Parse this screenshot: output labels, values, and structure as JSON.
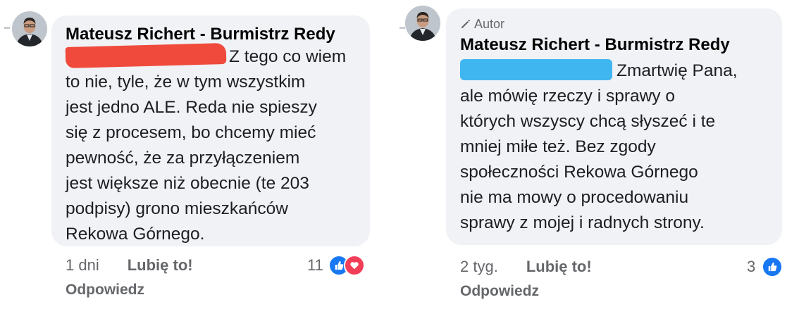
{
  "comments": [
    {
      "author": "Mateusz Richert - Burmistrz Redy",
      "lines": [
        "Z tego co wiem",
        "to nie, tyle, że w tym wszystkim",
        "jest jedno ALE. Reda nie spieszy",
        "się z procesem, bo chcemy mieć",
        "pewność, że za przyłączeniem",
        "jest większe niż obecnie (te 203",
        "podpisy) grono mieszkańców",
        "Rekowa Górnego."
      ],
      "time": "1 dni",
      "like_label": "Lubię to!",
      "reply_label": "Odpowiedz",
      "reaction_count": "11",
      "reactions": [
        "like-icon",
        "heart-icon"
      ]
    },
    {
      "badge": "Autor",
      "author": "Mateusz Richert - Burmistrz Redy",
      "lines": [
        "Zmartwię Pana,",
        "ale mówię rzeczy i sprawy o",
        "których wszyscy chcą słyszeć i te",
        "mniej miłe też. Bez zgody",
        "społeczności Rekowa Górnego",
        "nie ma mowy o procedowaniu",
        "sprawy z mojej i radnych strony."
      ],
      "time": "2 tyg.",
      "like_label": "Lubię to!",
      "reply_label": "Odpowiedz",
      "reaction_count": "3",
      "reactions": [
        "like-icon"
      ]
    }
  ],
  "colors": {
    "bubble": "#f0f2f5",
    "meta_text": "#65676b",
    "like_blue": "#1877f2",
    "heart_red": "#f33e58",
    "redaction_red": "#ef4a3b",
    "redaction_blue": "#3fb6f0"
  }
}
